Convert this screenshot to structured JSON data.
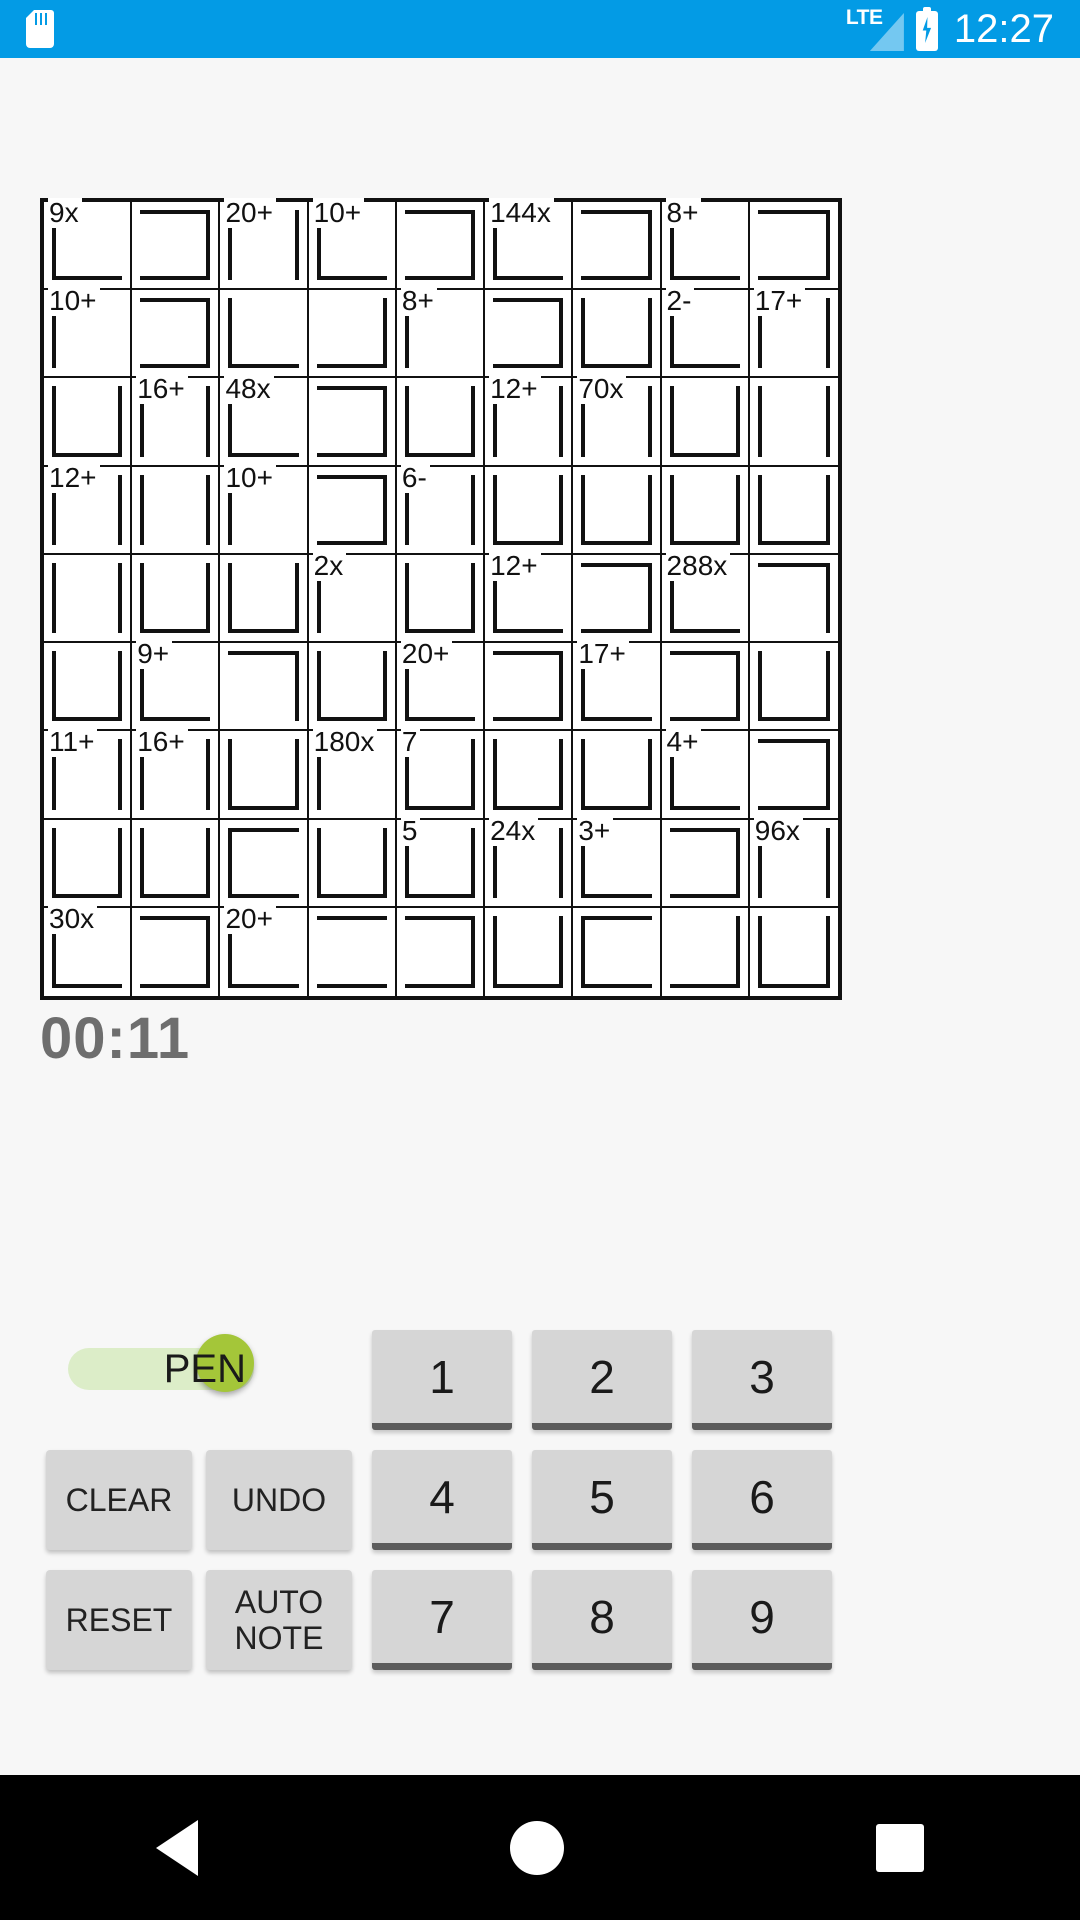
{
  "statusbar": {
    "sd_icon": "sd-card-icon",
    "network_label": "LTE",
    "signal_icon": "signal-bars-icon",
    "battery_icon": "battery-charging-icon",
    "time": "12:27",
    "background_color": "#039BE5"
  },
  "puzzle": {
    "size": 9,
    "type": "calcudoku",
    "cells": [
      {
        "r": 0,
        "c": 0,
        "label": "9x",
        "cage": "c1",
        "in": "lb"
      },
      {
        "r": 0,
        "c": 1,
        "label": "",
        "cage": "c1",
        "in": "trb"
      },
      {
        "r": 0,
        "c": 2,
        "label": "20+",
        "cage": "c2",
        "in": "lr"
      },
      {
        "r": 0,
        "c": 3,
        "label": "10+",
        "cage": "c3",
        "in": "lb"
      },
      {
        "r": 0,
        "c": 4,
        "label": "",
        "cage": "c3",
        "in": "trb"
      },
      {
        "r": 0,
        "c": 5,
        "label": "144x",
        "cage": "c4",
        "in": "lb"
      },
      {
        "r": 0,
        "c": 6,
        "label": "",
        "cage": "c4",
        "in": "trb"
      },
      {
        "r": 0,
        "c": 7,
        "label": "8+",
        "cage": "c5",
        "in": "lb"
      },
      {
        "r": 0,
        "c": 8,
        "label": "",
        "cage": "c5",
        "in": "trb"
      },
      {
        "r": 1,
        "c": 0,
        "label": "10+",
        "cage": "c6",
        "in": "l"
      },
      {
        "r": 1,
        "c": 1,
        "label": "",
        "cage": "c6",
        "in": "trb"
      },
      {
        "r": 1,
        "c": 2,
        "label": "",
        "cage": "c2",
        "in": "lb"
      },
      {
        "r": 1,
        "c": 3,
        "label": "",
        "cage": "c2",
        "in": "rb"
      },
      {
        "r": 1,
        "c": 4,
        "label": "8+",
        "cage": "c7",
        "in": "l"
      },
      {
        "r": 1,
        "c": 5,
        "label": "",
        "cage": "c7",
        "in": "trb"
      },
      {
        "r": 1,
        "c": 6,
        "label": "",
        "cage": "c4",
        "in": "lrb"
      },
      {
        "r": 1,
        "c": 7,
        "label": "2-",
        "cage": "c8",
        "in": "lb"
      },
      {
        "r": 1,
        "c": 8,
        "label": "17+",
        "cage": "c9",
        "in": "lr"
      },
      {
        "r": 2,
        "c": 0,
        "label": "",
        "cage": "c6",
        "in": "lrb"
      },
      {
        "r": 2,
        "c": 1,
        "label": "16+",
        "cage": "c10",
        "in": "lr"
      },
      {
        "r": 2,
        "c": 2,
        "label": "48x",
        "cage": "c11",
        "in": "lb"
      },
      {
        "r": 2,
        "c": 3,
        "label": "",
        "cage": "c11",
        "in": "trb"
      },
      {
        "r": 2,
        "c": 4,
        "label": "",
        "cage": "c7",
        "in": "lrb"
      },
      {
        "r": 2,
        "c": 5,
        "label": "12+",
        "cage": "c12",
        "in": "lr"
      },
      {
        "r": 2,
        "c": 6,
        "label": "70x",
        "cage": "c13",
        "in": "lr"
      },
      {
        "r": 2,
        "c": 7,
        "label": "",
        "cage": "c8",
        "in": "lrb"
      },
      {
        "r": 2,
        "c": 8,
        "label": "",
        "cage": "c9",
        "in": "lr"
      },
      {
        "r": 3,
        "c": 0,
        "label": "12+",
        "cage": "c14",
        "in": "lr"
      },
      {
        "r": 3,
        "c": 1,
        "label": "",
        "cage": "c10",
        "in": "lr"
      },
      {
        "r": 3,
        "c": 2,
        "label": "10+",
        "cage": "c15",
        "in": "l"
      },
      {
        "r": 3,
        "c": 3,
        "label": "",
        "cage": "c15",
        "in": "trb"
      },
      {
        "r": 3,
        "c": 4,
        "label": "6-",
        "cage": "c16",
        "in": "lr"
      },
      {
        "r": 3,
        "c": 5,
        "label": "",
        "cage": "c12",
        "in": "lrb"
      },
      {
        "r": 3,
        "c": 6,
        "label": "",
        "cage": "c13",
        "in": "lrb"
      },
      {
        "r": 3,
        "c": 7,
        "label": "",
        "cage": "c8",
        "in": "lrb"
      },
      {
        "r": 3,
        "c": 8,
        "label": "",
        "cage": "c9",
        "in": "lrb"
      },
      {
        "r": 4,
        "c": 0,
        "label": "",
        "cage": "c14",
        "in": "lr"
      },
      {
        "r": 4,
        "c": 1,
        "label": "",
        "cage": "c10",
        "in": "lrb"
      },
      {
        "r": 4,
        "c": 2,
        "label": "",
        "cage": "c15",
        "in": "lrb"
      },
      {
        "r": 4,
        "c": 3,
        "label": "2x",
        "cage": "c17",
        "in": "l"
      },
      {
        "r": 4,
        "c": 4,
        "label": "",
        "cage": "c16",
        "in": "lrb"
      },
      {
        "r": 4,
        "c": 5,
        "label": "12+",
        "cage": "c18",
        "in": "lb"
      },
      {
        "r": 4,
        "c": 6,
        "label": "",
        "cage": "c18",
        "in": "trb"
      },
      {
        "r": 4,
        "c": 7,
        "label": "288x",
        "cage": "c19",
        "in": "lb"
      },
      {
        "r": 4,
        "c": 8,
        "label": "",
        "cage": "c19",
        "in": "tr"
      },
      {
        "r": 5,
        "c": 0,
        "label": "",
        "cage": "c14",
        "in": "lrb"
      },
      {
        "r": 5,
        "c": 1,
        "label": "9+",
        "cage": "c20",
        "in": "lb"
      },
      {
        "r": 5,
        "c": 2,
        "label": "",
        "cage": "c20",
        "in": "tr"
      },
      {
        "r": 5,
        "c": 3,
        "label": "",
        "cage": "c17",
        "in": "lrb"
      },
      {
        "r": 5,
        "c": 4,
        "label": "20+",
        "cage": "c21",
        "in": "lb"
      },
      {
        "r": 5,
        "c": 5,
        "label": "",
        "cage": "c21",
        "in": "trb"
      },
      {
        "r": 5,
        "c": 6,
        "label": "17+",
        "cage": "c22",
        "in": "lb"
      },
      {
        "r": 5,
        "c": 7,
        "label": "",
        "cage": "c22",
        "in": "trb"
      },
      {
        "r": 5,
        "c": 8,
        "label": "",
        "cage": "c19",
        "in": "lrb"
      },
      {
        "r": 6,
        "c": 0,
        "label": "11+",
        "cage": "c23",
        "in": "lr"
      },
      {
        "r": 6,
        "c": 1,
        "label": "16+",
        "cage": "c24",
        "in": "lr"
      },
      {
        "r": 6,
        "c": 2,
        "label": "",
        "cage": "c20",
        "in": "lrb"
      },
      {
        "r": 6,
        "c": 3,
        "label": "180x",
        "cage": "c25",
        "in": "l"
      },
      {
        "r": 6,
        "c": 4,
        "label": "7",
        "cage": "c26",
        "in": "lrb"
      },
      {
        "r": 6,
        "c": 5,
        "label": "",
        "cage": "c21",
        "in": "lrb"
      },
      {
        "r": 6,
        "c": 6,
        "label": "",
        "cage": "c22",
        "in": "lrb"
      },
      {
        "r": 6,
        "c": 7,
        "label": "4+",
        "cage": "c27",
        "in": "lb"
      },
      {
        "r": 6,
        "c": 8,
        "label": "",
        "cage": "c27",
        "in": "trb"
      },
      {
        "r": 7,
        "c": 0,
        "label": "",
        "cage": "c23",
        "in": "lrb"
      },
      {
        "r": 7,
        "c": 1,
        "label": "",
        "cage": "c24",
        "in": "lrb"
      },
      {
        "r": 7,
        "c": 2,
        "label": "",
        "cage": "c28",
        "in": "ltb"
      },
      {
        "r": 7,
        "c": 3,
        "label": "",
        "cage": "c25",
        "in": "lrb"
      },
      {
        "r": 7,
        "c": 4,
        "label": "5",
        "cage": "c29",
        "in": "lrb"
      },
      {
        "r": 7,
        "c": 5,
        "label": "24x",
        "cage": "c30",
        "in": "lr"
      },
      {
        "r": 7,
        "c": 6,
        "label": "3+",
        "cage": "c31",
        "in": "lb"
      },
      {
        "r": 7,
        "c": 7,
        "label": "",
        "cage": "c31",
        "in": "trb"
      },
      {
        "r": 7,
        "c": 8,
        "label": "96x",
        "cage": "c32",
        "in": "lr"
      },
      {
        "r": 8,
        "c": 0,
        "label": "30x",
        "cage": "c33",
        "in": "lb"
      },
      {
        "r": 8,
        "c": 1,
        "label": "",
        "cage": "c33",
        "in": "trb"
      },
      {
        "r": 8,
        "c": 2,
        "label": "20+",
        "cage": "c34",
        "in": "lb"
      },
      {
        "r": 8,
        "c": 3,
        "label": "",
        "cage": "c34",
        "in": "tb"
      },
      {
        "r": 8,
        "c": 4,
        "label": "",
        "cage": "c34",
        "in": "trb"
      },
      {
        "r": 8,
        "c": 5,
        "label": "",
        "cage": "c30",
        "in": "lrb"
      },
      {
        "r": 8,
        "c": 6,
        "label": "",
        "cage": "c35",
        "in": "ltb"
      },
      {
        "r": 8,
        "c": 7,
        "label": "",
        "cage": "c35",
        "in": "rb"
      },
      {
        "r": 8,
        "c": 8,
        "label": "",
        "cage": "c32",
        "in": "lrb"
      }
    ],
    "cage_labels": [
      "9x",
      "20+",
      "10+",
      "144x",
      "8+",
      "10+",
      "8+",
      "2-",
      "17+",
      "16+",
      "48x",
      "12+",
      "70x",
      "12+",
      "10+",
      "6-",
      "2x",
      "12+",
      "288x",
      "9+",
      "20+",
      "17+",
      "11+",
      "16+",
      "180x",
      "7",
      "4+",
      "5",
      "24x",
      "3+",
      "96x",
      "30x",
      "20+"
    ]
  },
  "timer": {
    "value": "00:11"
  },
  "pen_toggle": {
    "label": "PEN",
    "state": "on",
    "track_color": "#dcedc8",
    "thumb_color": "#a4c639"
  },
  "actions": [
    {
      "label": "CLEAR",
      "name": "clear-button"
    },
    {
      "label": "UNDO",
      "name": "undo-button"
    },
    {
      "label": "RESET",
      "name": "reset-button"
    },
    {
      "label": "AUTO\nNOTE",
      "name": "auto-note-button"
    }
  ],
  "numpad": [
    "1",
    "2",
    "3",
    "4",
    "5",
    "6",
    "7",
    "8",
    "9"
  ],
  "navbar": {
    "back": "back-triangle-icon",
    "home": "home-circle-icon",
    "recents": "recents-square-icon"
  }
}
